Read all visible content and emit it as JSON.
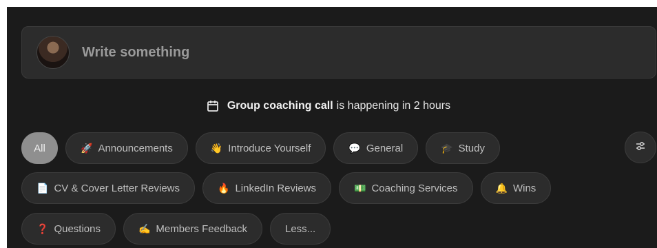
{
  "composer": {
    "placeholder": "Write something"
  },
  "event": {
    "title": "Group coaching call",
    "rest": "is happening in 2 hours"
  },
  "categories": {
    "row1": [
      {
        "label": "All",
        "emoji": ""
      },
      {
        "label": "Announcements",
        "emoji": "🚀"
      },
      {
        "label": "Introduce Yourself",
        "emoji": "👋"
      },
      {
        "label": "General",
        "emoji": "💬"
      },
      {
        "label": "Study",
        "emoji": "🎓"
      }
    ],
    "row2": [
      {
        "label": "CV & Cover Letter Reviews",
        "emoji": "📄"
      },
      {
        "label": "LinkedIn Reviews",
        "emoji": "🔥"
      },
      {
        "label": "Coaching Services",
        "emoji": "💵"
      },
      {
        "label": "Wins",
        "emoji": "🔔"
      }
    ],
    "row3": [
      {
        "label": "Questions",
        "emoji": "❓"
      },
      {
        "label": "Members Feedback",
        "emoji": "✍️"
      },
      {
        "label": "Less...",
        "emoji": ""
      }
    ]
  },
  "icons": {
    "calendar": "calendar-icon",
    "filter": "sliders-icon"
  }
}
